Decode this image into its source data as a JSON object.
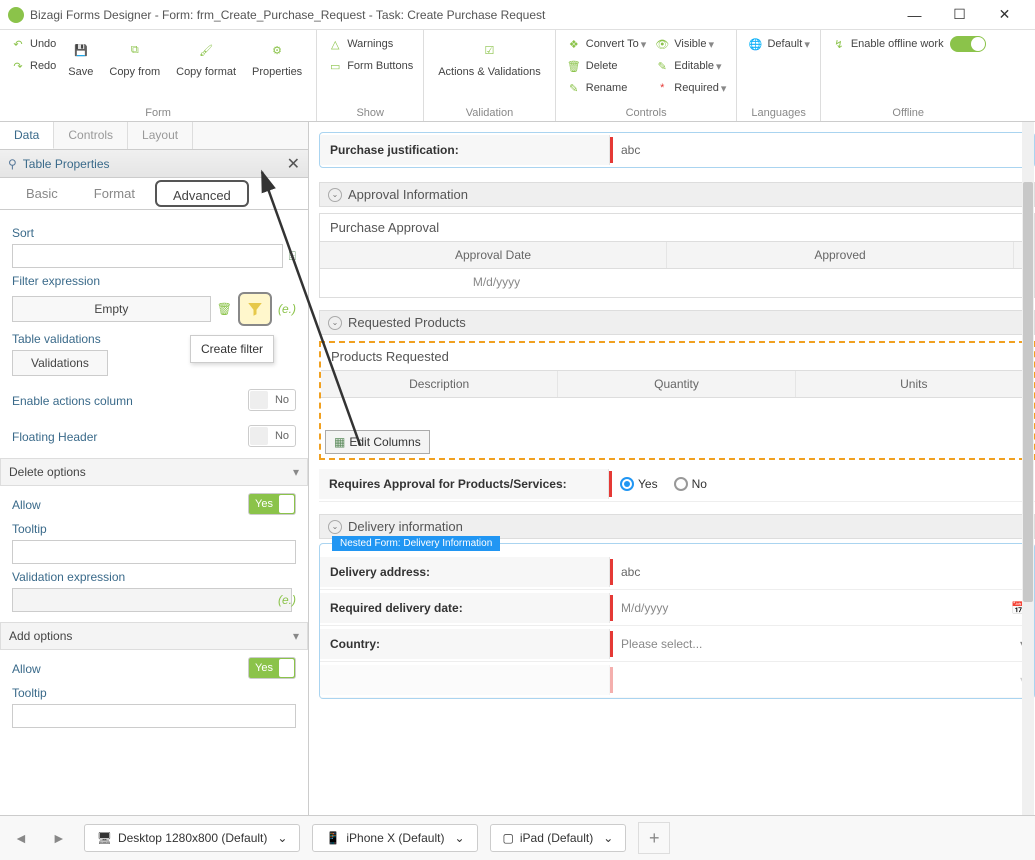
{
  "window": {
    "title": "Bizagi Forms Designer  -  Form: frm_Create_Purchase_Request - Task:  Create Purchase Request"
  },
  "ribbon": {
    "undo": "Undo",
    "redo": "Redo",
    "save": "Save",
    "copyfrom": "Copy from",
    "copyformat": "Copy format",
    "properties": "Properties",
    "warnings": "Warnings",
    "formbuttons": "Form Buttons",
    "actionsval": "Actions & Validations",
    "convert": "Convert To",
    "delete": "Delete",
    "rename": "Rename",
    "visible": "Visible",
    "editable": "Editable",
    "required": "Required",
    "default": "Default",
    "offline": "Enable offline work",
    "groups": {
      "form": "Form",
      "show": "Show",
      "validation": "Validation",
      "controls": "Controls",
      "languages": "Languages",
      "offline": "Offline"
    }
  },
  "left": {
    "tabs": {
      "data": "Data",
      "controls": "Controls",
      "layout": "Layout"
    },
    "panelTitle": "Table Properties",
    "subtabs": {
      "basic": "Basic",
      "format": "Format",
      "advanced": "Advanced"
    },
    "sort": "Sort",
    "filterexpr": "Filter expression",
    "filterbtn": "Empty",
    "createfilter": "Create filter",
    "tableval": "Table validations",
    "validationsBtn": "Validations",
    "enableactions": "Enable actions column",
    "floatingheader": "Floating Header",
    "no": "No",
    "yes": "Yes",
    "deleteoptions": "Delete options",
    "allow": "Allow",
    "tooltip": "Tooltip",
    "valexpr": "Validation expression",
    "addoptions": "Add options"
  },
  "canvas": {
    "purchasejust": "Purchase justification:",
    "abc": "abc",
    "approvalinfo": "Approval Information",
    "purchaseapproval": "Purchase Approval",
    "approvaldate": "Approval Date",
    "approved": "Approved",
    "mdyyyy": "M/d/yyyy",
    "reqproducts": "Requested Products",
    "productsreq": "Products Requested",
    "description": "Description",
    "quantity": "Quantity",
    "units": "Units",
    "editcols": "Edit Columns",
    "reqapproval": "Requires Approval for Products/Services:",
    "yesopt": "Yes",
    "noopt": "No",
    "deliveryinfo": "Delivery information",
    "nestedform": "Nested Form: Delivery Information",
    "deliveryaddr": "Delivery address:",
    "reqdelivdate": "Required delivery date:",
    "country": "Country:",
    "pleaseselect": "Please select..."
  },
  "bottom": {
    "desktop": "Desktop 1280x800 (Default)",
    "iphone": "iPhone X (Default)",
    "ipad": "iPad (Default)"
  }
}
